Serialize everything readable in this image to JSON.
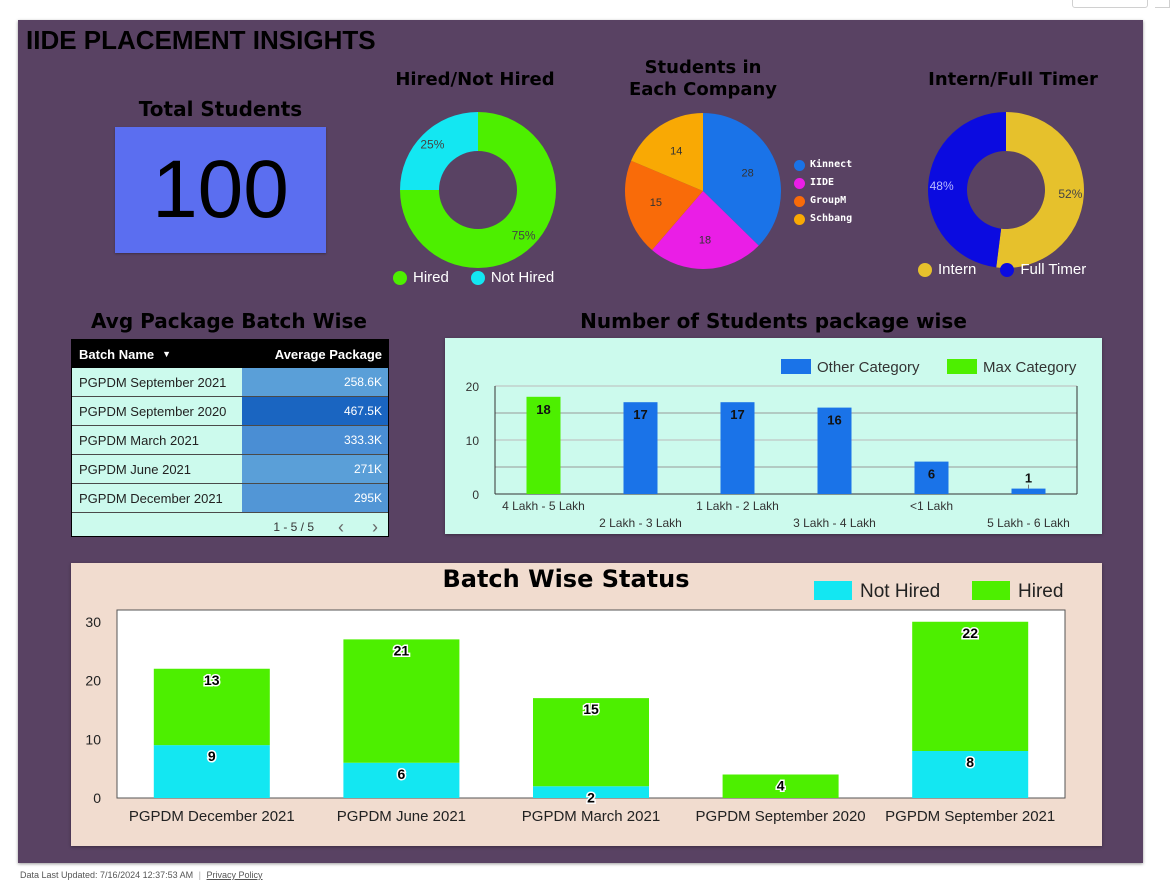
{
  "report_title": "IIDE PLACEMENT INSIGHTS",
  "total_students": {
    "title": "Total Students",
    "value": "100"
  },
  "hired_chart": {
    "title": "Hired/Not Hired",
    "chart_data": {
      "type": "pie",
      "donut": true,
      "slices": [
        {
          "name": "Hired",
          "value": 75,
          "label": "75%",
          "color": "#4def00"
        },
        {
          "name": "Not Hired",
          "value": 25,
          "label": "25%",
          "color": "#13e7f2"
        }
      ]
    },
    "legend": [
      {
        "label": "Hired",
        "color": "#4def00"
      },
      {
        "label": "Not Hired",
        "color": "#13e7f2"
      }
    ]
  },
  "company_chart": {
    "title_line1": "Students in",
    "title_line2": "Each Company",
    "chart_data": {
      "type": "pie",
      "slices": [
        {
          "name": "Kinnect",
          "value": 28,
          "color": "#1a73e8"
        },
        {
          "name": "IIDE",
          "value": 18,
          "color": "#ea1ee6"
        },
        {
          "name": "GroupM",
          "value": 15,
          "color": "#f96b09"
        },
        {
          "name": "Schbang",
          "value": 14,
          "color": "#f9a904"
        }
      ]
    },
    "legend": [
      {
        "label": "Kinnect",
        "color": "#1a73e8"
      },
      {
        "label": "IIDE",
        "color": "#ea1ee6"
      },
      {
        "label": "GroupM",
        "color": "#f96b09"
      },
      {
        "label": "Schbang",
        "color": "#f9a904"
      }
    ]
  },
  "intern_chart": {
    "title": "Intern/Full Timer",
    "chart_data": {
      "type": "pie",
      "donut": true,
      "slices": [
        {
          "name": "Intern",
          "value": 52,
          "label": "52%",
          "color": "#e6c12c"
        },
        {
          "name": "Full Timer",
          "value": 48,
          "label": "48%",
          "color": "#0b0be0"
        }
      ]
    },
    "legend": [
      {
        "label": "Intern",
        "color": "#e6c12c"
      },
      {
        "label": "Full Timer",
        "color": "#0b0be0"
      }
    ]
  },
  "avg_package": {
    "title": "Avg Package Batch Wise",
    "col_name": "Batch Name",
    "col_value": "Average Package",
    "rows": [
      {
        "name": "PGPDM September 2021",
        "value": "258.6K",
        "color": "#5a9fd8"
      },
      {
        "name": "PGPDM September 2020",
        "value": "467.5K",
        "color": "#1a65c1"
      },
      {
        "name": "PGPDM March 2021",
        "value": "333.3K",
        "color": "#4a8ed4"
      },
      {
        "name": "PGPDM June 2021",
        "value": "271K",
        "color": "#5a9fd8"
      },
      {
        "name": "PGPDM December 2021",
        "value": "295K",
        "color": "#5296d6"
      }
    ],
    "pager": "1 - 5 / 5"
  },
  "package_chart": {
    "title": "Number of Students package wise",
    "legend": [
      {
        "label": "Other Category",
        "color": "#1a73e8"
      },
      {
        "label": "Max Category",
        "color": "#4def00"
      }
    ],
    "chart_data": {
      "type": "bar",
      "categories": [
        "4 Lakh - 5 Lakh",
        "2 Lakh - 3 Lakh",
        "1 Lakh - 2 Lakh",
        "3 Lakh - 4 Lakh",
        "<1 Lakh",
        "5 Lakh - 6 Lakh"
      ],
      "values": [
        18,
        17,
        17,
        16,
        6,
        1
      ],
      "max_category_index": 0,
      "ylim": [
        0,
        20
      ],
      "yticks": [
        "0",
        "10",
        "20"
      ]
    }
  },
  "batch_chart": {
    "title": "Batch Wise Status",
    "legend": [
      {
        "label": "Not Hired",
        "color": "#13e7f2"
      },
      {
        "label": "Hired",
        "color": "#4def00"
      }
    ],
    "chart_data": {
      "type": "bar",
      "stacked": true,
      "categories": [
        "PGPDM December 2021",
        "PGPDM June 2021",
        "PGPDM March 2021",
        "PGPDM September 2020",
        "PGPDM September 2021"
      ],
      "series": [
        {
          "name": "Not Hired",
          "values": [
            9,
            6,
            2,
            0,
            8
          ],
          "color": "#13e7f2"
        },
        {
          "name": "Hired",
          "values": [
            13,
            21,
            15,
            4,
            22
          ],
          "color": "#4def00"
        }
      ],
      "ylim": [
        0,
        32
      ],
      "yticks": [
        "0",
        "10",
        "20",
        "30"
      ]
    }
  },
  "footer": {
    "updated": "Data Last Updated: 7/16/2024 12:37:53 AM",
    "separator": "|",
    "privacy": "Privacy Policy"
  }
}
